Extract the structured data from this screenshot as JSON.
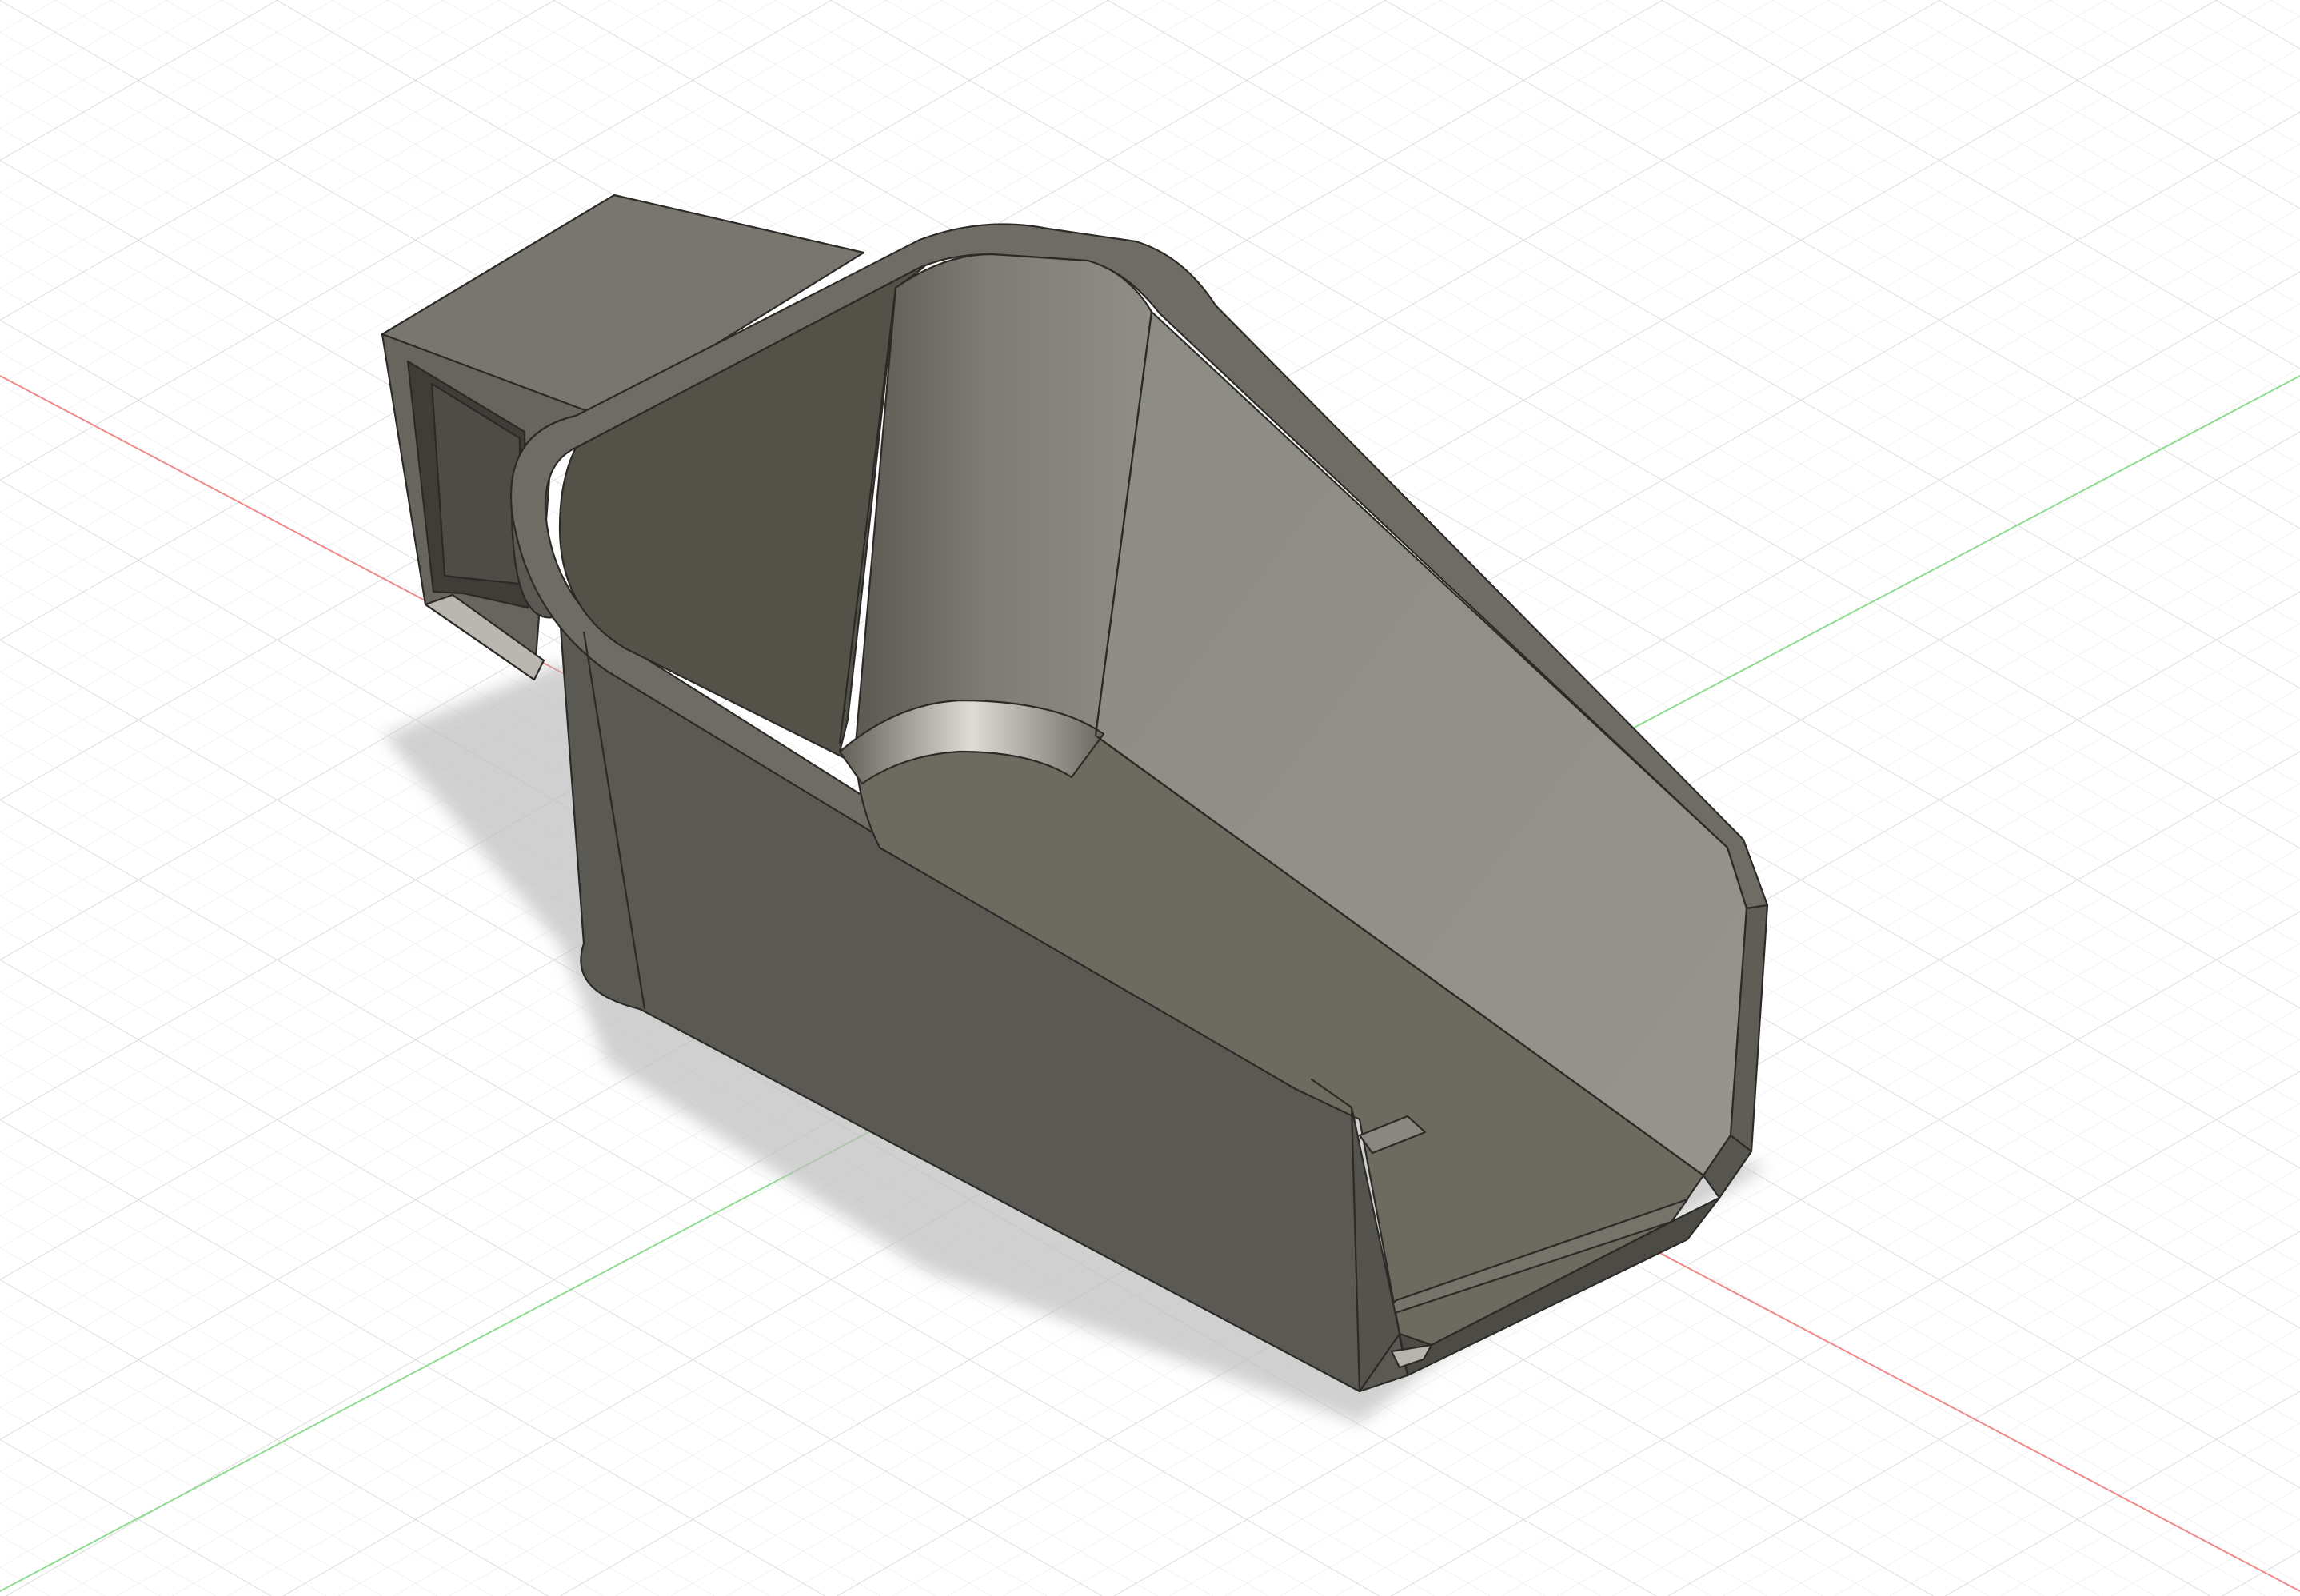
{
  "viewport": {
    "name": "cad-3d-viewport",
    "background": "#ffffff",
    "grid_minor_color": "#e6e6e6",
    "grid_major_color": "#d2d2d2",
    "x_axis_color": "#f08a8a",
    "y_axis_color": "#8fdc8f",
    "edge_color": "#2b2a26"
  },
  "model": {
    "name": "funnel-chute-part",
    "shell_top_color": "#6e6c64",
    "outer_wall_left_color": "#5a5953",
    "inner_wall_right_color": "#8f8e87",
    "inner_wall_back_color": "#545148",
    "curved_back_color": "#717068",
    "floor_color": "#6d6a60",
    "box_top_color": "#797670",
    "shadow_color": "#bdbdbd"
  }
}
